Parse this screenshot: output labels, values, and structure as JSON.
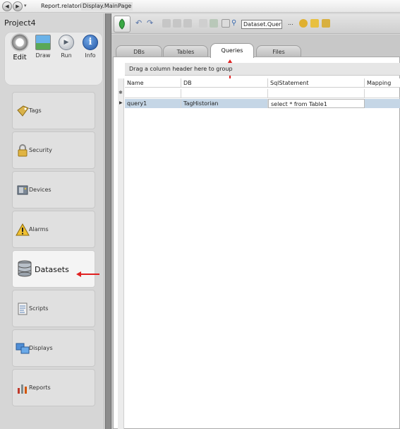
{
  "topbar": {
    "doc_tabs": [
      "Report.relatorio",
      "Display.MainPage"
    ]
  },
  "project": {
    "title": "Project4"
  },
  "actions": [
    {
      "label": "Edit",
      "icon": "gear-icon"
    },
    {
      "label": "Draw",
      "icon": "picture-icon"
    },
    {
      "label": "Run",
      "icon": "play-icon"
    },
    {
      "label": "Info",
      "icon": "info-icon"
    }
  ],
  "nav": [
    {
      "label": "Tags",
      "icon": "tags-icon"
    },
    {
      "label": "Security",
      "icon": "lock-icon"
    },
    {
      "label": "Devices",
      "icon": "device-icon"
    },
    {
      "label": "Alarms",
      "icon": "warning-icon"
    },
    {
      "label": "Datasets",
      "icon": "database-icon",
      "active": true
    },
    {
      "label": "Scripts",
      "icon": "script-icon"
    },
    {
      "label": "Displays",
      "icon": "displays-icon"
    },
    {
      "label": "Reports",
      "icon": "reports-icon"
    }
  ],
  "toolbar": {
    "breadcrumb": "Dataset.Query.c",
    "more_label": "..."
  },
  "tabs": [
    "DBs",
    "Tables",
    "Queries",
    "Files"
  ],
  "active_tab": "Queries",
  "grid": {
    "group_hint": "Drag a column header here to group",
    "columns": [
      "Name",
      "DB",
      "SqlStatement",
      "Mapping"
    ],
    "rows": [
      {
        "name": "query1",
        "db": "TagHistorian",
        "sql": "select * from Table1",
        "mapping": ""
      }
    ]
  },
  "colors": {
    "arrow": "#e02020",
    "selected_row": "#c5d6e6"
  }
}
